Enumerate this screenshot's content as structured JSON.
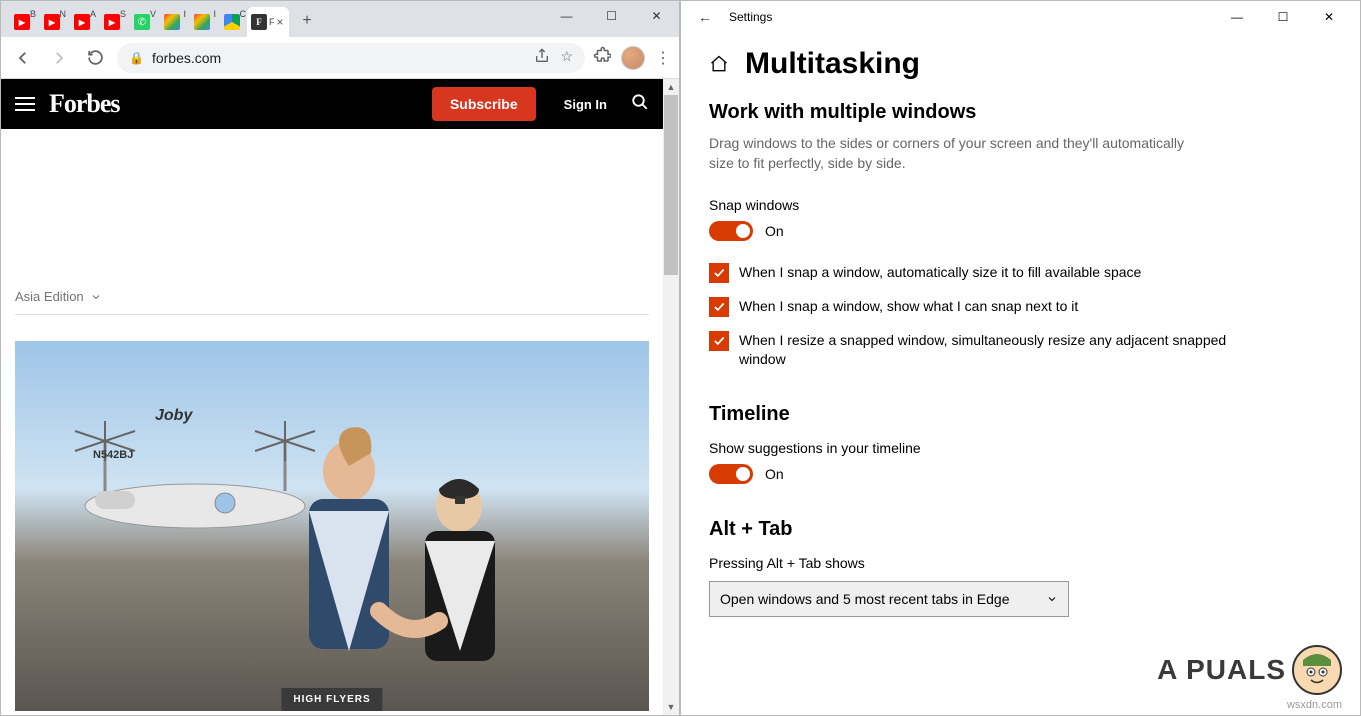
{
  "chrome": {
    "tabs": [
      {
        "letter": "B"
      },
      {
        "letter": "N"
      },
      {
        "letter": "A"
      },
      {
        "letter": "S"
      },
      {
        "letter": "V"
      },
      {
        "letter": "I"
      },
      {
        "letter": "I"
      },
      {
        "letter": "C"
      },
      {
        "letter": "F",
        "active": true
      }
    ],
    "url": "forbes.com",
    "forbes": {
      "logo": "Forbes",
      "subscribe": "Subscribe",
      "signin": "Sign In",
      "edition": "Asia Edition",
      "planeBrand": "Joby",
      "tailNumber": "N542BJ",
      "badge": "HIGH FLYERS"
    }
  },
  "settings": {
    "windowTitle": "Settings",
    "pageTitle": "Multitasking",
    "work": {
      "title": "Work with multiple windows",
      "desc": "Drag windows to the sides or corners of your screen and they'll automatically size to fit perfectly, side by side.",
      "snapLabel": "Snap windows",
      "snapState": "On",
      "check1": "When I snap a window, automatically size it to fill available space",
      "check2": "When I snap a window, show what I can snap next to it",
      "check3": "When I resize a snapped window, simultaneously resize any adjacent snapped window"
    },
    "timeline": {
      "title": "Timeline",
      "suggestLabel": "Show suggestions in your timeline",
      "suggestState": "On"
    },
    "altTab": {
      "title": "Alt + Tab",
      "label": "Pressing Alt + Tab shows",
      "value": "Open windows and 5 most recent tabs in Edge"
    }
  },
  "watermark": {
    "text": "A  PUALS",
    "site": "wsxdn.com"
  }
}
